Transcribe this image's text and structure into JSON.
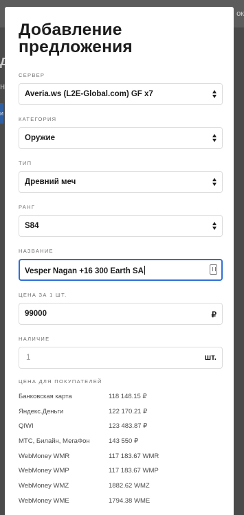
{
  "background": {
    "top_right_fragment": "ок",
    "left_heading_fragment": "д",
    "left_text_fragment": "н",
    "left_button_fragment": "и"
  },
  "modal": {
    "title": "Добавление предложения"
  },
  "form": {
    "server": {
      "label": "СЕРВЕР",
      "value": "Averia.ws (L2E-Global.com) GF x7"
    },
    "category": {
      "label": "КАТЕГОРИЯ",
      "value": "Оружие"
    },
    "type": {
      "label": "ТИП",
      "value": "Древний меч"
    },
    "rank": {
      "label": "РАНГ",
      "value": "S84"
    },
    "name": {
      "label": "НАЗВАНИЕ",
      "value": "Vesper Nagan +16 300 Earth SA"
    },
    "price": {
      "label": "ЦЕНА ЗА 1 ШТ.",
      "value": "99000",
      "currency": "₽"
    },
    "stock": {
      "label": "НАЛИЧИЕ",
      "placeholder": "1",
      "unit": "шт."
    }
  },
  "buyer_prices": {
    "label": "ЦЕНА ДЛЯ ПОКУПАТЕЛЕЙ",
    "rows": [
      {
        "method": "Банковская карта",
        "amount": "118 148.15 ₽"
      },
      {
        "method": "Яндекс.Деньги",
        "amount": "122 170.21 ₽"
      },
      {
        "method": "QIWI",
        "amount": "123 483.87 ₽"
      },
      {
        "method": "МТС, Билайн, МегаФон",
        "amount": "143 550 ₽"
      },
      {
        "method": "WebMoney WMR",
        "amount": "117 183.67 WMR"
      },
      {
        "method": "WebMoney WMP",
        "amount": "117 183.67 WMP"
      },
      {
        "method": "WebMoney WMZ",
        "amount": "1882.62 WMZ"
      },
      {
        "method": "WebMoney WME",
        "amount": "1794.38 WME"
      }
    ]
  }
}
